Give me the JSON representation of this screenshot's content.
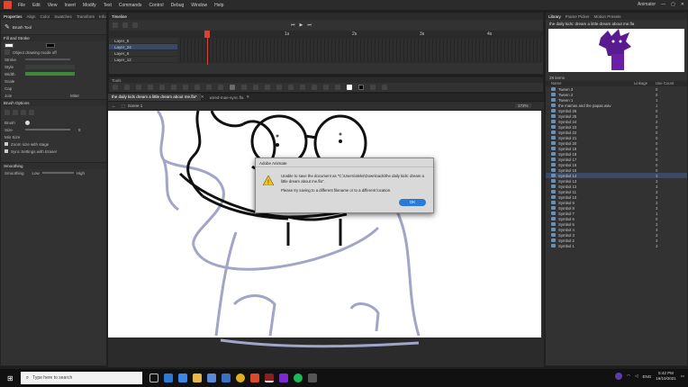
{
  "menubar": {
    "items": [
      "File",
      "Edit",
      "View",
      "Insert",
      "Modify",
      "Text",
      "Commands",
      "Control",
      "Debug",
      "Window",
      "Help"
    ],
    "workspace": "Animator"
  },
  "properties": {
    "tabs": [
      "Properties",
      "Align",
      "Color",
      "Swatches",
      "Transform",
      "Info"
    ],
    "tool_name": "Brush Tool",
    "fill_stroke_title": "Fill and Stroke",
    "object_drawing": "Object drawing mode off",
    "stroke_label": "Stroke",
    "style_label": "Style",
    "width_label": "Width",
    "scale_label": "Scale",
    "cap_label": "Cap",
    "join_label": "Join",
    "miter_label": "Miter",
    "brush_options_title": "Brush Options",
    "brush_label": "Brush",
    "size_label": "Size",
    "size_value": "8",
    "min_size_label": "Min Size",
    "zoom_with_stage": "Zoom size with stage",
    "sync_settings": "Sync Settings with Eraser",
    "smoothing_title": "Smoothing",
    "smoothing_label": "Smoothing",
    "low": "Low",
    "high": "High"
  },
  "timeline": {
    "title": "Timeline",
    "frame_numbers": [
      "1s",
      "2s",
      "3s",
      "4s",
      "5s"
    ],
    "layers": [
      {
        "name": "Layer_5",
        "selected": false
      },
      {
        "name": "Layer_24",
        "selected": true
      },
      {
        "name": "Layer_6",
        "selected": false
      },
      {
        "name": "Layer_12",
        "selected": false
      }
    ]
  },
  "tools": {
    "title": "Tools"
  },
  "document": {
    "tabs": [
      "the daily kids dream a little dream about me.fla*",
      "wired-mae-sync.fla"
    ],
    "scene": "Scene 1",
    "zoom": "172%"
  },
  "library": {
    "tabs": [
      "Library",
      "Frame Picker",
      "Motion Presets"
    ],
    "file": "the daily kids: dream a little dream about me.fla",
    "items_count": "28 items",
    "col_name": "Name",
    "col_linkage": "Linkage",
    "col_use": "Use Count",
    "items": [
      {
        "name": "Tween 3",
        "use": "0"
      },
      {
        "name": "Tween 2",
        "use": "0"
      },
      {
        "name": "Tween 1",
        "use": "1"
      },
      {
        "name": "the mamas and the papas.wav",
        "use": "1"
      },
      {
        "name": "Symbol 26",
        "use": "0"
      },
      {
        "name": "Symbol 25",
        "use": "0"
      },
      {
        "name": "Symbol 24",
        "use": "2"
      },
      {
        "name": "Symbol 23",
        "use": "0"
      },
      {
        "name": "Symbol 22",
        "use": "0"
      },
      {
        "name": "Symbol 21",
        "use": "0"
      },
      {
        "name": "Symbol 20",
        "use": "0"
      },
      {
        "name": "Symbol 19",
        "use": "0"
      },
      {
        "name": "Symbol 18",
        "use": "0"
      },
      {
        "name": "Symbol 17",
        "use": "0"
      },
      {
        "name": "Symbol 16",
        "use": "0"
      },
      {
        "name": "Symbol 15",
        "use": "0"
      },
      {
        "name": "Symbol 14",
        "use": "3"
      },
      {
        "name": "Symbol 13",
        "use": "3"
      },
      {
        "name": "Symbol 12",
        "use": "3"
      },
      {
        "name": "Symbol 11",
        "use": "3"
      },
      {
        "name": "Symbol 10",
        "use": "3"
      },
      {
        "name": "Symbol 9",
        "use": "3"
      },
      {
        "name": "Symbol 8",
        "use": "3"
      },
      {
        "name": "Symbol 7",
        "use": "1"
      },
      {
        "name": "Symbol 6",
        "use": "0"
      },
      {
        "name": "Symbol 5",
        "use": "3"
      },
      {
        "name": "Symbol 4",
        "use": "3"
      },
      {
        "name": "Symbol 3",
        "use": "3"
      },
      {
        "name": "Symbol 2",
        "use": "3"
      },
      {
        "name": "Symbol 1",
        "use": "3"
      }
    ],
    "selected_index": 16
  },
  "dialog": {
    "title": "Adobe Animate",
    "message": "Unable to save the document as \"C:\\Users\\aleks\\Downloads\\the daily kids: dream a little dream about me.fla\".",
    "hint": "Please try saving to a different filename or to a different location.",
    "ok": "OK"
  },
  "taskbar": {
    "search_placeholder": "Type here to search",
    "time": "5:42 PM",
    "date": "16/10/2021",
    "lang": "ENG"
  },
  "colors": {
    "accent": "#2b7bd6",
    "dialog_bg": "#d9d9d9",
    "sketch": "#a2a4c8",
    "purple": "#6a1fa8"
  }
}
